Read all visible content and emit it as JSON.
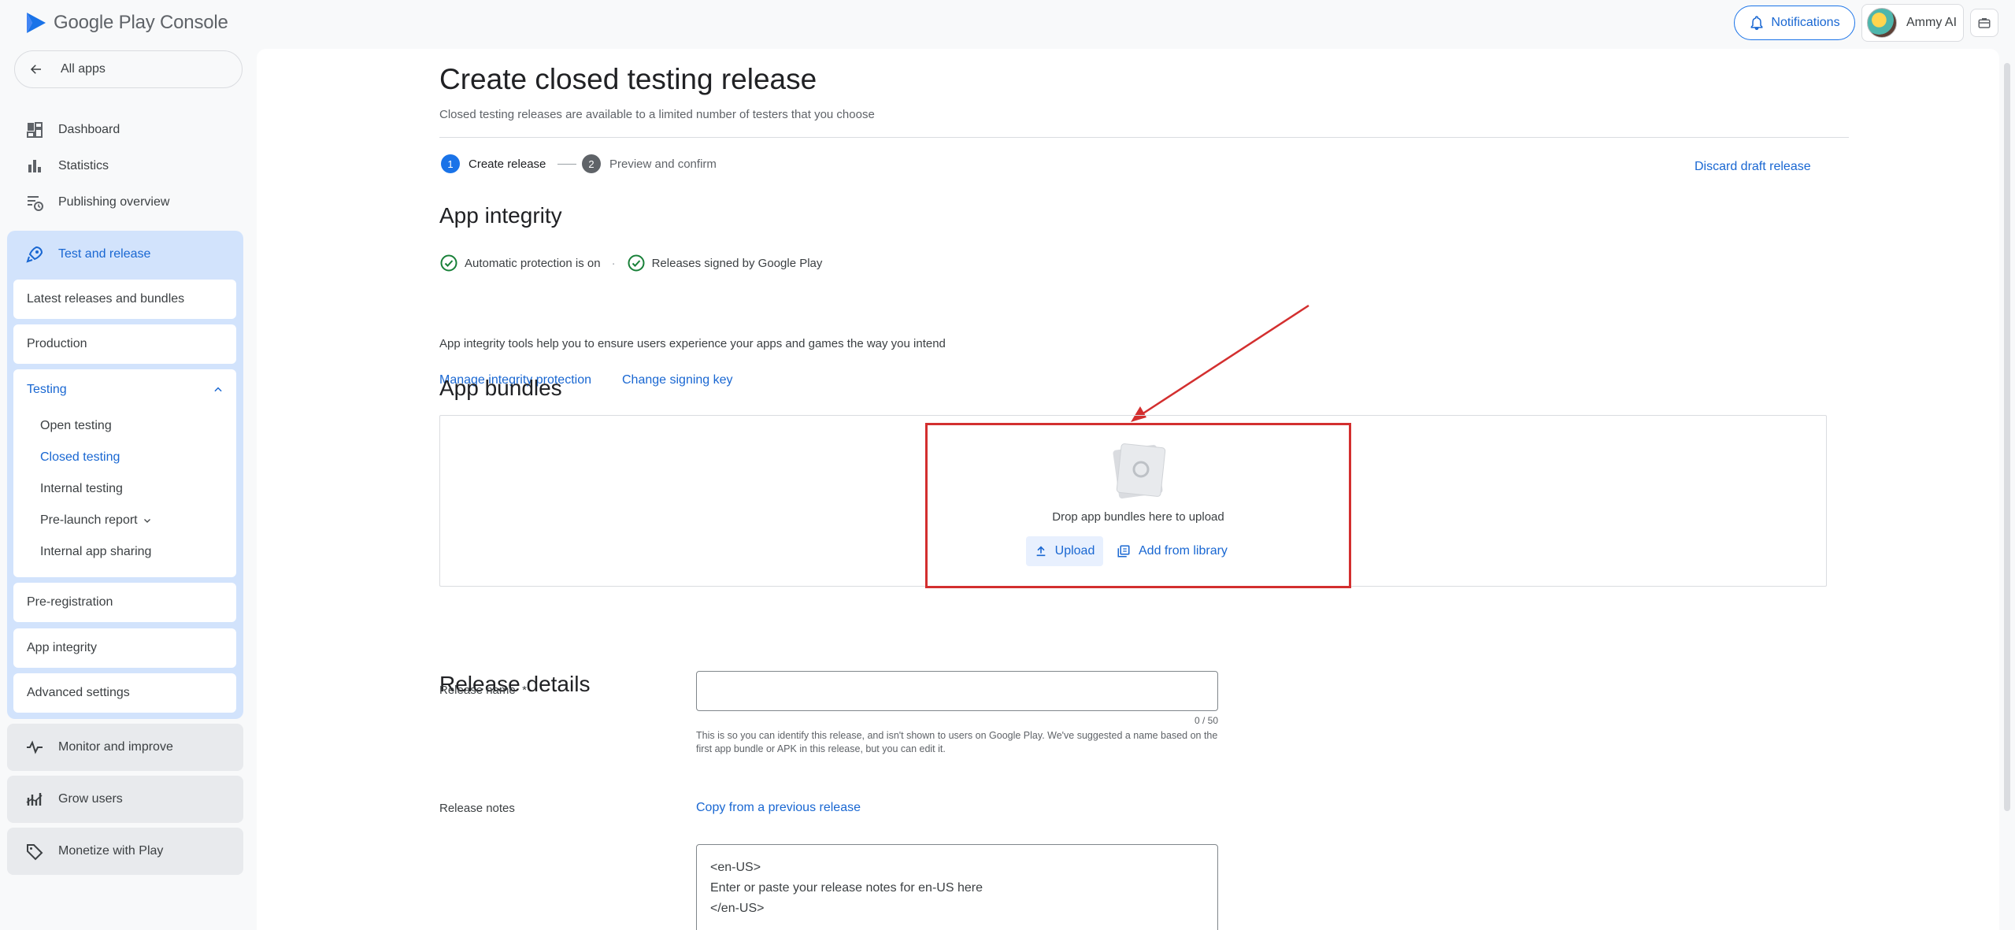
{
  "app": {
    "logo_prefix": "Google Play",
    "logo_suffix": "Console",
    "notifications_label": "Notifications",
    "account_name": "Ammy AI"
  },
  "sidebar": {
    "all_apps": "All apps",
    "top_items": [
      {
        "label": "Dashboard",
        "icon": "dashboard-icon"
      },
      {
        "label": "Statistics",
        "icon": "bar-chart-icon"
      },
      {
        "label": "Publishing overview",
        "icon": "publishing-icon"
      }
    ],
    "test_release": {
      "label": "Test and release",
      "items": {
        "latest": "Latest releases and bundles",
        "production": "Production",
        "testing": "Testing",
        "testing_sub": [
          "Open testing",
          "Closed testing",
          "Internal testing",
          "Pre-launch report",
          "Internal app sharing"
        ],
        "preregistration": "Pre-registration",
        "app_integrity": "App integrity",
        "advanced": "Advanced settings"
      }
    },
    "bottom_groups": [
      {
        "label": "Monitor and improve",
        "icon": "pulse-icon"
      },
      {
        "label": "Grow users",
        "icon": "grow-icon"
      },
      {
        "label": "Monetize with Play",
        "icon": "tag-icon"
      }
    ]
  },
  "main": {
    "title": "Create closed testing release",
    "subtitle": "Closed testing releases are available to a limited number of testers that you choose",
    "steps": [
      {
        "num": "1",
        "label": "Create release"
      },
      {
        "num": "2",
        "label": "Preview and confirm"
      }
    ],
    "discard_label": "Discard draft release",
    "integrity": {
      "heading": "App integrity",
      "status_1": "Automatic protection is on",
      "status_2": "Releases signed by Google Play",
      "description": "App integrity tools help you to ensure users experience your apps and games the way you intend",
      "link_1": "Manage integrity protection",
      "link_2": "Change signing key"
    },
    "bundles": {
      "heading": "App bundles",
      "drop_text": "Drop app bundles here to upload",
      "upload_label": "Upload",
      "library_label": "Add from library"
    },
    "release_details": {
      "heading": "Release details",
      "name_label": "Release name",
      "required_mark": "*",
      "name_value": "",
      "counter": "0 / 50",
      "helper": "This is so you can identify this release, and isn't shown to users on Google Play. We've suggested a name based on the first app bundle or APK in this release, but you can edit it.",
      "notes_label": "Release notes",
      "copy_link": "Copy from a previous release",
      "notes_value": "<en-US>\nEnter or paste your release notes for en-US here\n</en-US>"
    }
  },
  "colors": {
    "accent": "#1967d2",
    "highlight": "#d32f2f",
    "success": "#188038"
  }
}
